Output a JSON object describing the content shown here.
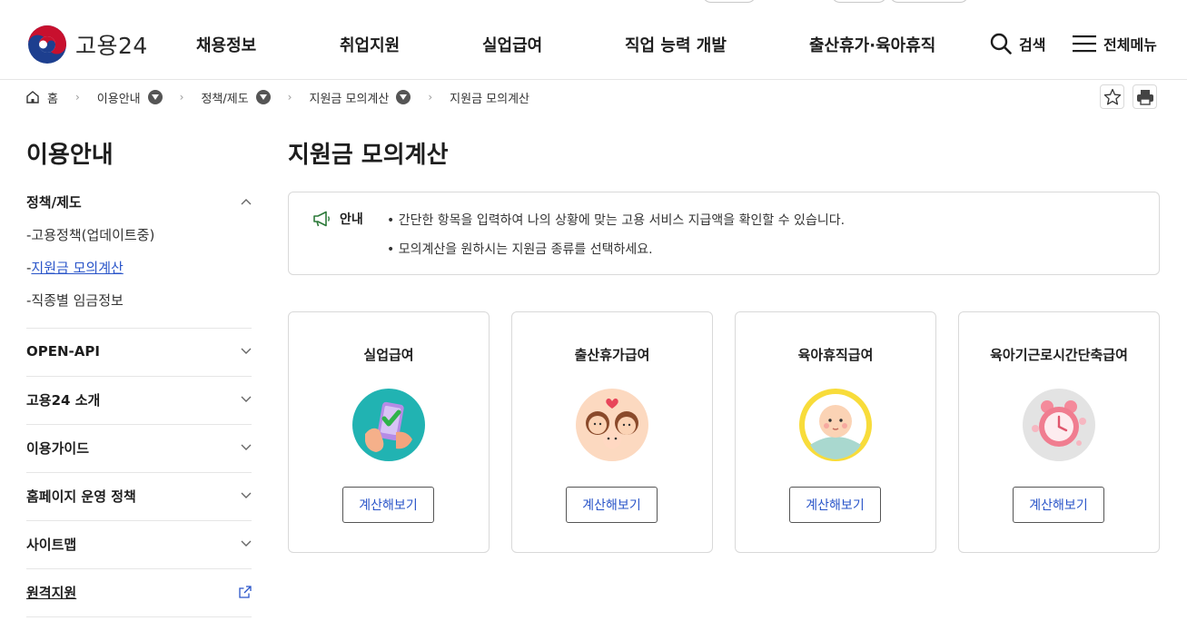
{
  "header": {
    "logo_text": "고용24",
    "nav": [
      "채용정보",
      "취업지원",
      "실업급여",
      "직업 능력 개발",
      "출산휴가·육아휴직"
    ],
    "search_label": "검색",
    "menu_label": "전체메뉴"
  },
  "breadcrumb": {
    "home": "홈",
    "items": [
      "이용안내",
      "정책/제도",
      "지원금 모의계산",
      "지원금 모의계산"
    ]
  },
  "sidebar": {
    "title": "이용안내",
    "groups": [
      {
        "label": "정책/제도",
        "expanded": true,
        "items": [
          "고용정책(업데이트중)",
          "지원금 모의계산",
          "직종별 임금정보"
        ],
        "active_index": 1
      },
      {
        "label": "OPEN-API"
      },
      {
        "label": "고용24 소개"
      },
      {
        "label": "이용가이드"
      },
      {
        "label": "홈페이지 운영 정책"
      },
      {
        "label": "사이트맵"
      },
      {
        "label": "원격지원"
      }
    ]
  },
  "main": {
    "title": "지원금 모의계산",
    "notice": {
      "label": "안내",
      "lines": [
        "• 간단한 항목을 입력하여 나의 상황에 맞는 고용 서비스 지급액을 확인할 수 있습니다.",
        "• 모의계산을 원하시는 지원금 종류를 선택하세요."
      ]
    },
    "cards": [
      {
        "title": "실업급여",
        "button": "계산해보기",
        "icon": "phone-hand-icon"
      },
      {
        "title": "출산휴가급여",
        "button": "계산해보기",
        "icon": "family-icon"
      },
      {
        "title": "육아휴직급여",
        "button": "계산해보기",
        "icon": "baby-icon"
      },
      {
        "title": "육아기근로시간단축급여",
        "button": "계산해보기",
        "icon": "alarm-clock-icon"
      }
    ]
  },
  "colors": {
    "link": "#2a55c9",
    "logo_red": "#c8102e",
    "logo_blue": "#1d3f8f",
    "notice_icon": "#2d7a3a"
  }
}
